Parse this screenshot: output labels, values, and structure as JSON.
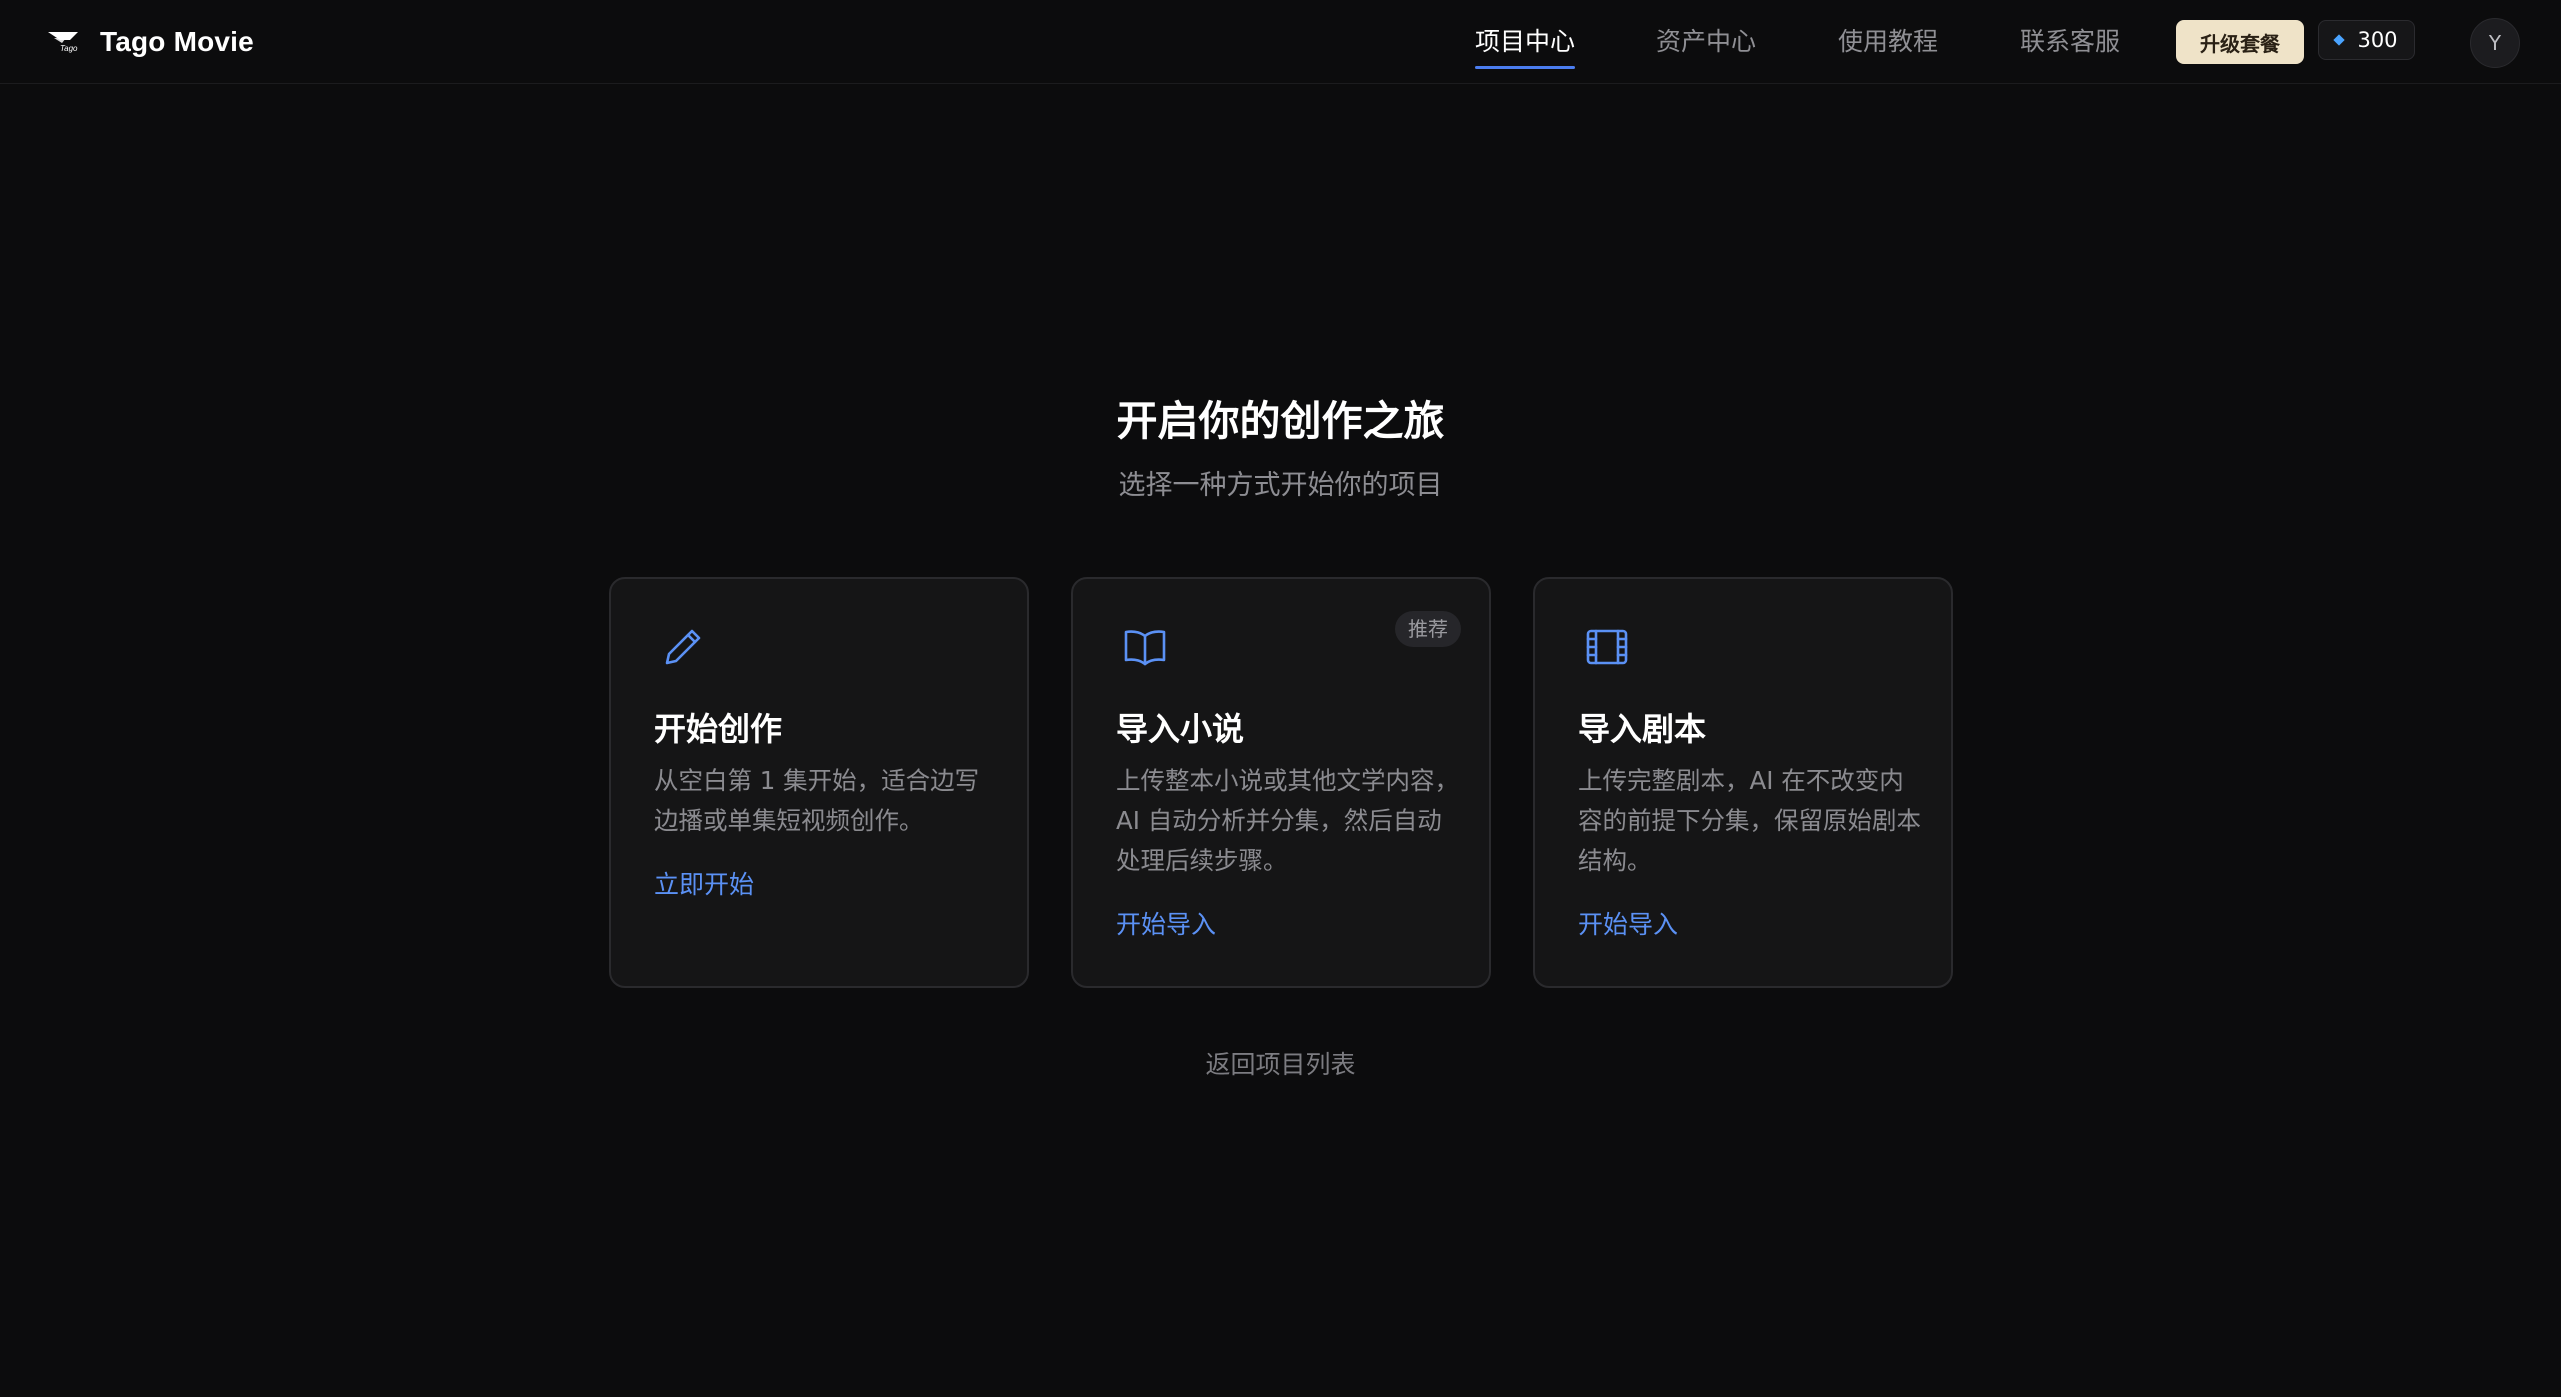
{
  "header": {
    "brand_name": "Tago Movie",
    "logo_text": "Tago",
    "nav": [
      {
        "label": "项目中心",
        "active": true
      },
      {
        "label": "资产中心",
        "active": false
      },
      {
        "label": "使用教程",
        "active": false
      },
      {
        "label": "联系客服",
        "active": false
      }
    ],
    "upgrade_label": "升级套餐",
    "credits": "300",
    "avatar_initial": "Y"
  },
  "hero": {
    "title": "开启你的创作之旅",
    "subtitle": "选择一种方式开始你的项目"
  },
  "cards": [
    {
      "icon": "pencil-icon",
      "title": "开始创作",
      "description": "从空白第 1 集开始，适合边写边播或单集短视频创作。",
      "action": "立即开始",
      "badge": ""
    },
    {
      "icon": "book-open-icon",
      "title": "导入小说",
      "description": "上传整本小说或其他文学内容，AI 自动分析并分集，然后自动处理后续步骤。",
      "action": "开始导入",
      "badge": "推荐"
    },
    {
      "icon": "film-icon",
      "title": "导入剧本",
      "description": "上传完整剧本，AI 在不改变内容的前提下分集，保留原始剧本结构。",
      "action": "开始导入",
      "badge": ""
    }
  ],
  "back_link": "返回项目列表",
  "colors": {
    "background": "#0c0c0d",
    "card_background": "#151516",
    "card_border": "#2a2a2d",
    "accent_blue": "#5b91f5",
    "upgrade_button": "#efe3c8",
    "credit_diamond": "#4aa3ff"
  }
}
